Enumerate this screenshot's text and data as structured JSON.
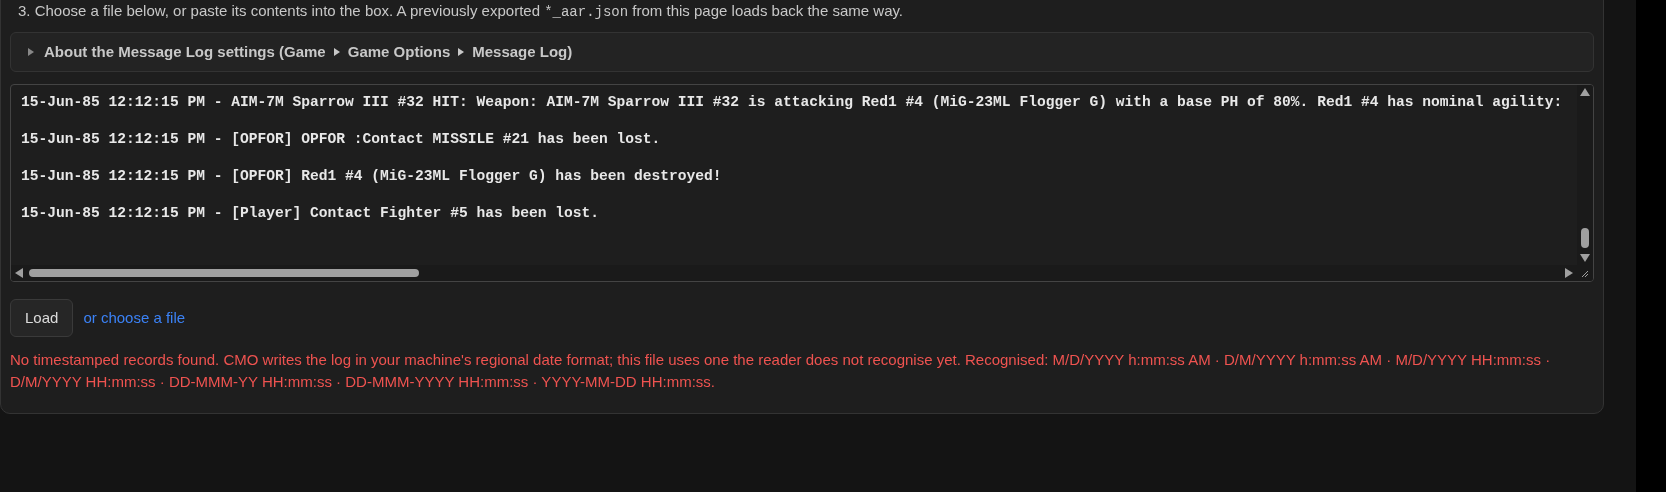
{
  "instructions": {
    "before": "3. Choose a file below, or paste its contents into the box. A previously exported ",
    "code": "*_aar.json",
    "after": " from this page loads back the same way."
  },
  "details": {
    "expanded": false,
    "parts": [
      "About the Message Log settings (Game",
      "Game Options",
      "Message Log)"
    ]
  },
  "log_lines": [
    "15-Jun-85 12:12:15 PM - AIM-7M Sparrow III #32 HIT: Weapon: AIM-7M Sparrow III #32 is attacking Red1 #4 (MiG-23ML Flogger G) with a base PH of 80%. Red1 #4 has nominal agility:",
    "15-Jun-85 12:12:15 PM - [OPFOR] OPFOR :Contact MISSILE #21 has been lost.",
    "15-Jun-85 12:12:15 PM - [OPFOR] Red1 #4 (MiG-23ML Flogger G) has been destroyed!",
    "15-Jun-85 12:12:15 PM - [Player] Contact Fighter #5 has been lost."
  ],
  "load_button": "Load",
  "file_link": "or choose a file",
  "error": "No timestamped records found. CMO writes the log in your machine's regional date format; this file uses one the reader does not recognise yet. Recognised: M/D/YYYY h:mm:ss AM · D/M/YYYY h:mm:ss AM · M/D/YYYY HH:mm:ss · D/M/YYYY HH:mm:ss · DD-MMM-YY HH:mm:ss · DD-MMM-YYYY HH:mm:ss · YYYY-MM-DD HH:mm:ss."
}
